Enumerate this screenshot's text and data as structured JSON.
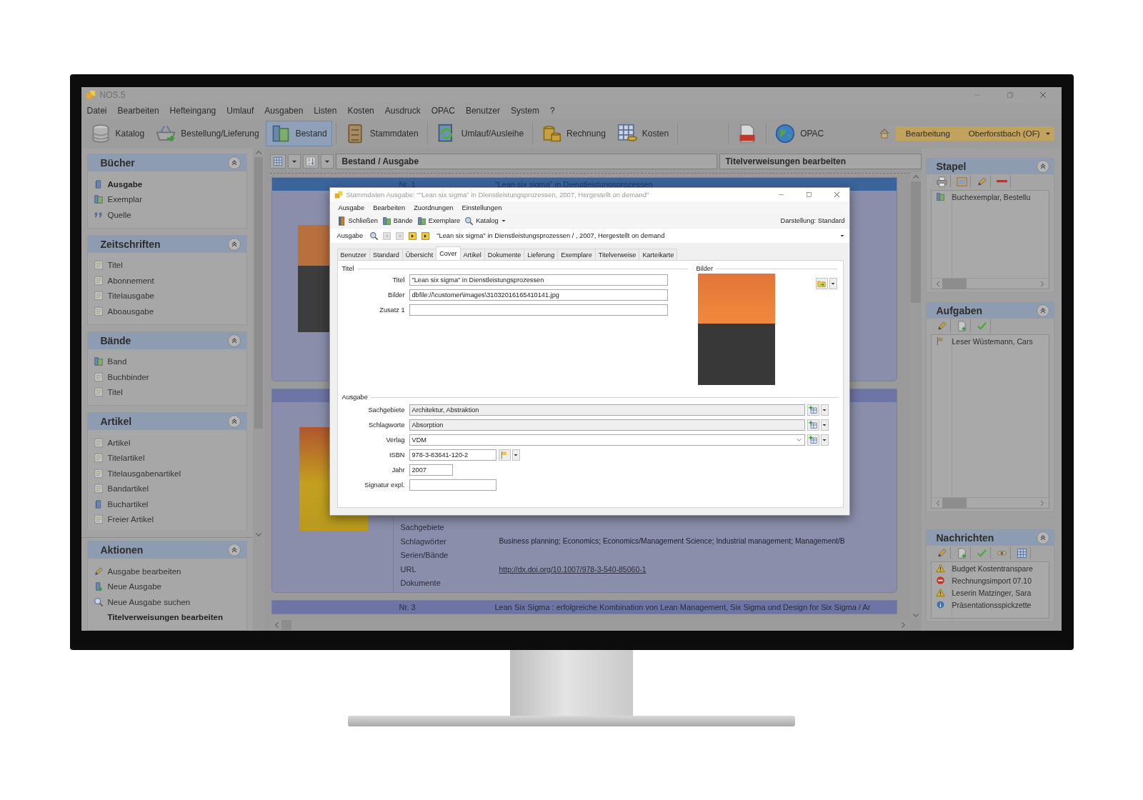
{
  "app": {
    "title": "NOS.5"
  },
  "menu": [
    "Datei",
    "Bearbeiten",
    "Hefteingang",
    "Umlauf",
    "Ausgaben",
    "Listen",
    "Kosten",
    "Ausdruck",
    "OPAC",
    "Benutzer",
    "System",
    "?"
  ],
  "toolbar": [
    {
      "label": "Katalog",
      "selected": false
    },
    {
      "label": "Bestellung/Lieferung",
      "selected": false
    },
    {
      "label": "Bestand",
      "selected": true
    },
    {
      "label": "Stammdaten",
      "selected": false
    },
    {
      "label": "Umlauf/Ausleihe",
      "selected": false
    },
    {
      "label": "Rechnung",
      "selected": false
    },
    {
      "label": "Kosten",
      "selected": false
    },
    {
      "selected": false
    },
    {
      "label": "OPAC",
      "selected": false
    }
  ],
  "mode": {
    "label": "Bearbeitung",
    "location": "Oberforstbach (OF)"
  },
  "sidebar": {
    "sections": [
      {
        "title": "Bücher",
        "items": [
          {
            "label": "Ausgabe",
            "selected": true
          },
          {
            "label": "Exemplar",
            "selected": false
          },
          {
            "label": "Quelle",
            "selected": false
          }
        ]
      },
      {
        "title": "Zeitschriften",
        "items": [
          {
            "label": "Titel",
            "selected": false
          },
          {
            "label": "Abonnement",
            "selected": false
          },
          {
            "label": "Titelausgabe",
            "selected": false
          },
          {
            "label": "Aboausgabe",
            "selected": false
          }
        ]
      },
      {
        "title": "Bände",
        "items": [
          {
            "label": "Band",
            "selected": false
          },
          {
            "label": "Buchbinder",
            "selected": false
          },
          {
            "label": "Titel",
            "selected": false
          }
        ]
      },
      {
        "title": "Artikel",
        "items": [
          {
            "label": "Artikel",
            "selected": false
          },
          {
            "label": "Titelartikel",
            "selected": false
          },
          {
            "label": "Titelausgabenartikel",
            "selected": false
          },
          {
            "label": "Bandartikel",
            "selected": false
          },
          {
            "label": "Buchartikel",
            "selected": false
          },
          {
            "label": "Freier Artikel",
            "selected": false
          }
        ]
      }
    ]
  },
  "actions": {
    "title": "Aktionen",
    "items": [
      {
        "label": "Ausgabe bearbeiten",
        "selected": false
      },
      {
        "label": "Neue Ausgabe",
        "selected": false
      },
      {
        "label": "Neue Ausgabe suchen",
        "selected": false
      },
      {
        "label": "Titelverweisungen bearbeiten",
        "selected": true
      }
    ]
  },
  "main": {
    "header": "Bestand / Ausgabe",
    "side_header": "Titelverweisungen bearbeiten",
    "records": [
      {
        "number": "Nr. 1",
        "title": "\"Lean six sigma\" in Dienstleistungsprozessen",
        "selected": true
      },
      {
        "selected": false,
        "fields": [
          {
            "label": "Sachgebiete"
          },
          {
            "label": "Schlagwörter",
            "kind": "text",
            "value": "Business planning; Economics; Economics/Management Science; Industrial management; Management/B"
          },
          {
            "label": "Serien/Bände"
          },
          {
            "label": "URL",
            "kind": "link",
            "value": "http://dx.doi.org/10.1007/978-3-540-85060-1"
          },
          {
            "label": "Dokumente"
          }
        ]
      },
      {
        "number": "Nr. 3",
        "title": "Lean Six Sigma : erfolgreiche Kombination von Lean Management, Six Sigma und Design for Six Sigma / Ar",
        "selected": false
      }
    ]
  },
  "right": {
    "panels": [
      {
        "title": "Stapel",
        "rows": [
          {
            "kind": "batch",
            "text": "Buchexemplar, Bestellu"
          }
        ]
      },
      {
        "title": "Aufgaben",
        "rows": [
          {
            "kind": "task",
            "text": "Leser Wüstemann, Cars"
          }
        ]
      },
      {
        "title": "Nachrichten",
        "rows": [
          {
            "kind": "warning",
            "text": "Budget Kostentranspare"
          },
          {
            "kind": "error",
            "text": "Rechnungsimport 07.10"
          },
          {
            "kind": "warning",
            "text": "Leserin Matzinger, Sara"
          },
          {
            "kind": "info",
            "text": "Präsentationsspickzette"
          }
        ]
      }
    ]
  },
  "dialog": {
    "title": "Stammdaten Ausgabe: \"\"Lean six sigma\" in Dienstleistungsprozessen, 2007, Hergestellt on demand\"",
    "menu": [
      "Ausgabe",
      "Bearbeiten",
      "Zuordnungen",
      "Einstellungen"
    ],
    "toolbar": [
      {
        "label": "Schließen",
        "kind": "button"
      },
      {
        "label": "Bände",
        "kind": "button"
      },
      {
        "label": "Exemplare",
        "kind": "button"
      },
      {
        "label": "Katalog",
        "kind": "dropdown"
      }
    ],
    "view": "Darstellung: Standard",
    "nav_label": "Ausgabe",
    "record": "\"Lean six sigma\" in Dienstleistungsprozessen / , 2007, Hergestellt on demand",
    "tabs": [
      {
        "label": "Benutzer",
        "selected": false
      },
      {
        "label": "Standard",
        "selected": false
      },
      {
        "label": "Übersicht",
        "selected": false
      },
      {
        "label": "Cover",
        "selected": true
      },
      {
        "label": "Artikel",
        "selected": false
      },
      {
        "label": "Dokumente",
        "selected": false
      },
      {
        "label": "Lieferung",
        "selected": false
      },
      {
        "label": "Exemplare",
        "selected": false
      },
      {
        "label": "Titelverweise",
        "selected": false
      },
      {
        "label": "Karteikarte",
        "selected": false
      }
    ],
    "titel_group": {
      "title": "Titel",
      "fields": [
        {
          "label": "Titel",
          "value": "\"Lean six sigma\" in Dienstleistungsprozessen"
        },
        {
          "label": "Bilder",
          "value": "dbfile://\\customer\\images\\31032016165410141.jpg"
        },
        {
          "label": "Zusatz 1"
        }
      ]
    },
    "bilder_group": {
      "title": "Bilder"
    },
    "ausgabe_group": {
      "title": "Ausgabe",
      "fields": [
        {
          "label": "Sachgebiete",
          "kind": "picker",
          "value": "Architektur, Abstraktion"
        },
        {
          "label": "Schlagworte",
          "kind": "picker",
          "value": "Absorption"
        },
        {
          "label": "Verlag",
          "kind": "combo",
          "value": "VDM"
        },
        {
          "label": "ISBN",
          "kind": "isbn",
          "value": "978-3-83641-120-2"
        },
        {
          "label": "Jahr",
          "kind": "short",
          "value": "2007"
        },
        {
          "label": "Signatur expl.",
          "kind": "medium"
        }
      ]
    }
  }
}
